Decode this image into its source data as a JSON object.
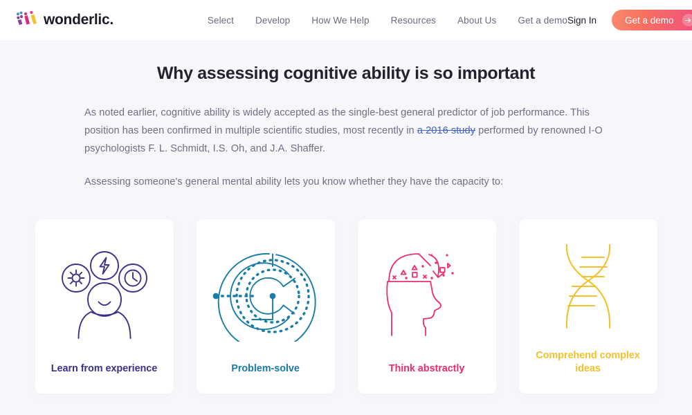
{
  "header": {
    "brand_name": "wonderlic.",
    "logo_icon": "wonderlic-dots-logo",
    "nav": [
      {
        "label": "Select"
      },
      {
        "label": "Develop"
      },
      {
        "label": "How We Help"
      },
      {
        "label": "Resources"
      },
      {
        "label": "About Us"
      },
      {
        "label": "Get a demo"
      }
    ],
    "signin_label": "Sign In",
    "cta_label": "Get a demo",
    "cta_icon": "arrow-right-icon",
    "cta_gradient_from": "#f98a6e",
    "cta_gradient_to": "#ef4f7e"
  },
  "main": {
    "headline": "Why assessing cognitive ability is so important",
    "paragraph_1": {
      "before_link": "As noted earlier, cognitive ability is widely accepted as the single-best general predictor of job performance. This position has been confirmed in multiple scientific studies, most recently in ",
      "link_text": "a 2016 study",
      "after_link": " performed by renowned I-O psychologists F. L. Schmidt, I.S. Oh, and J.A. Shaffer.",
      "link_color": "#3f63c9"
    },
    "paragraph_2": "Assessing someone's general mental ability lets you know whether they have the capacity to:",
    "cards": [
      {
        "label": "Learn from experience",
        "icon": "person-with-gear-bolt-clock-icon",
        "color": "#3b3288"
      },
      {
        "label": "Problem-solve",
        "icon": "circular-maze-icon",
        "color": "#1a7ca8"
      },
      {
        "label": "Think abstractly",
        "icon": "open-head-abstract-shapes-icon",
        "color": "#ec2d6b"
      },
      {
        "label": "Comprehend complex ideas",
        "icon": "dna-helix-icon",
        "color": "#f2c12e"
      }
    ]
  },
  "theme": {
    "page_background": "#f7f7fb",
    "header_background": "#ffffff",
    "card_background": "#ffffff",
    "body_text": "#6e6e85",
    "heading_text": "#23232f"
  }
}
